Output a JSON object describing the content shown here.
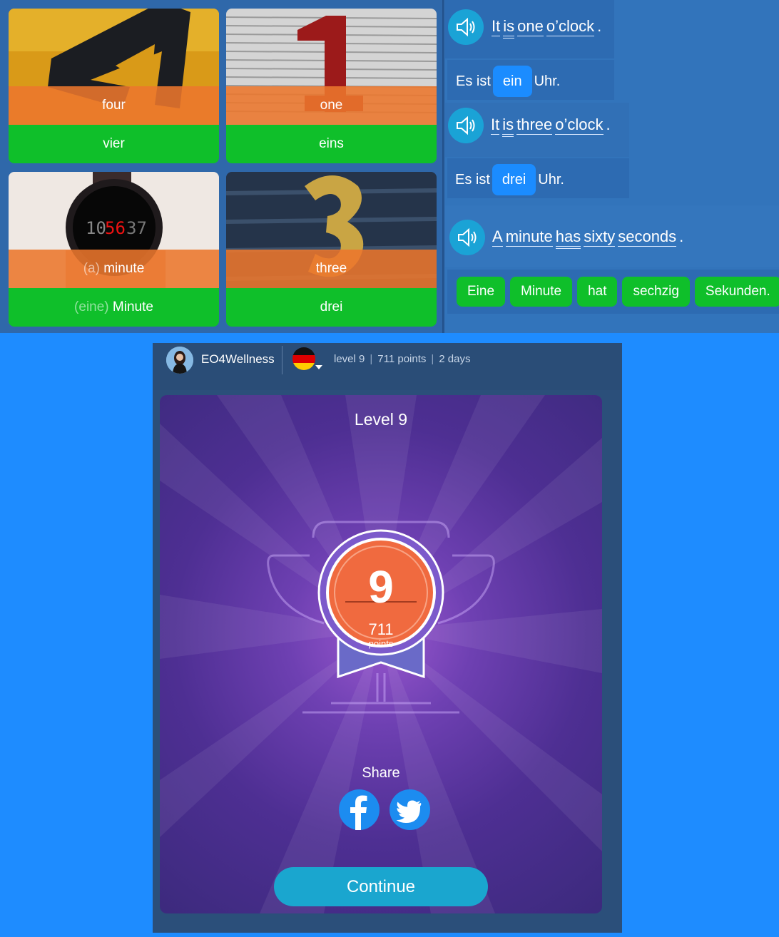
{
  "cards": [
    {
      "en": "four",
      "de": "vier"
    },
    {
      "en": "one",
      "de": "eins"
    },
    {
      "en_article": "(a)",
      "en": "minute",
      "de_article": "(eine)",
      "de": "Minute"
    },
    {
      "en": "three",
      "de": "drei"
    }
  ],
  "sentences": [
    {
      "en": [
        "It",
        "is",
        "one",
        "o’clock",
        "."
      ],
      "de_before": "Es ist",
      "de_chip": "ein",
      "de_after": "Uhr."
    },
    {
      "en": [
        "It",
        "is",
        "three",
        "o’clock",
        "."
      ],
      "de_before": "Es ist",
      "de_chip": "drei",
      "de_after": "Uhr."
    },
    {
      "en": [
        "A",
        "minute",
        "has",
        "sixty",
        "seconds",
        "."
      ],
      "de_tiles": [
        "Eine",
        "Minute",
        "hat",
        "sechzig",
        "Sekunden."
      ]
    }
  ],
  "header": {
    "username": "EO4Wellness",
    "level": "level 9",
    "points": "711 points",
    "days": "2 days",
    "language_flag": "germany-flag"
  },
  "modal": {
    "title": "Level 9",
    "badge_number": "9",
    "badge_points": "711",
    "badge_points_label": "points",
    "share_label": "Share",
    "continue_label": "Continue"
  },
  "colors": {
    "page_bg": "#1e8cff",
    "english_overlay": "#ec762c",
    "german_bar": "#0fbf2a",
    "modal_purple": "#6e40b2",
    "badge_orange": "#f06a3f",
    "continue_button": "#1aa6cf",
    "social_blue": "#1c8cf0"
  }
}
